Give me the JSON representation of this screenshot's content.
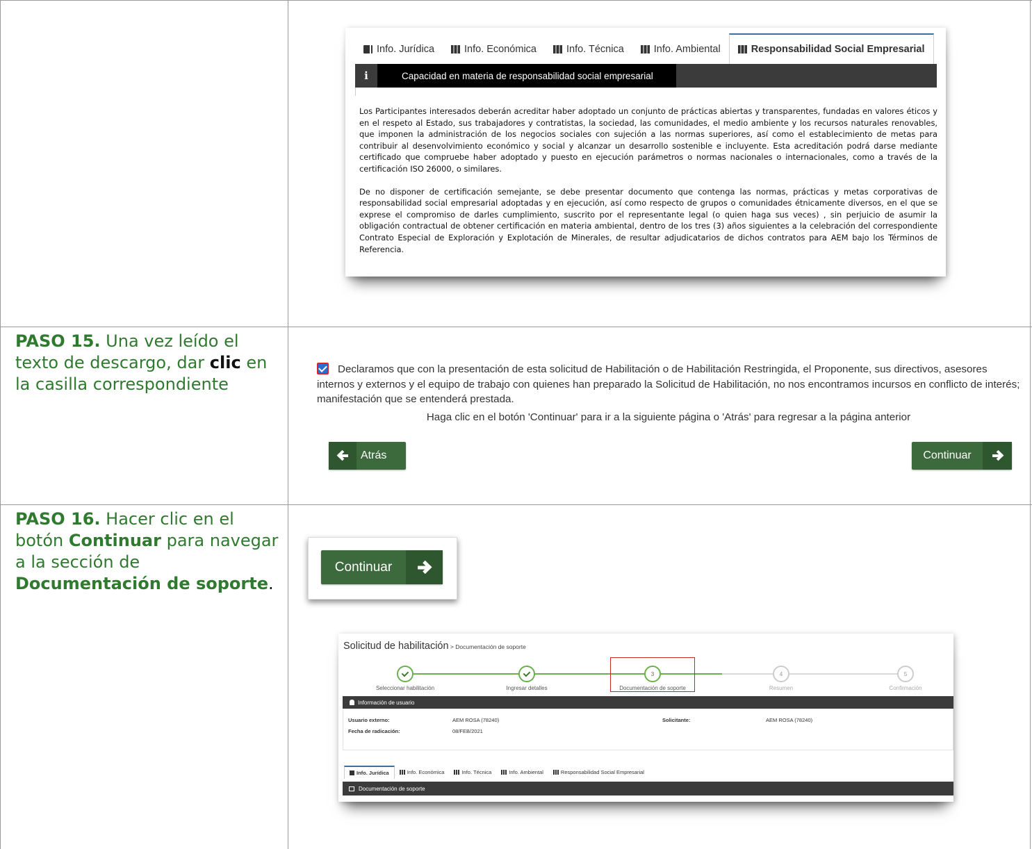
{
  "card1": {
    "tabs": [
      {
        "label": "Info. Jurídica",
        "icon": "book-icon"
      },
      {
        "label": "Info. Económica",
        "icon": "map-icon"
      },
      {
        "label": "Info. Técnica",
        "icon": "map-icon"
      },
      {
        "label": "Info. Ambiental",
        "icon": "map-icon"
      },
      {
        "label": "Responsabilidad Social Empresarial",
        "icon": "map-icon",
        "active": true
      }
    ],
    "info_icon": "i",
    "info_title": "Capacidad en materia de responsabilidad social empresarial",
    "paragraph1": "Los Participantes interesados deberán acreditar haber adoptado un conjunto de prácticas abiertas y transparentes, fundadas en valores éticos y en el respeto al Estado, sus trabajadores y contratistas, la sociedad, las comunidades, el medio ambiente y los recursos naturales renovables, que imponen la administración de los negocios sociales con sujeción a las normas superiores, así como el establecimiento de metas para contribuir al desenvolvimiento económico y social y alcanzar un desarrollo sostenible e incluyente. Esta acreditación podrá darse mediante certificado que compruebe haber adoptado y puesto en ejecución parámetros o normas nacionales o internacionales, como a través de la certificación ISO 26000, o similares.",
    "paragraph2": "De no disponer de certificación semejante, se debe presentar documento que contenga las normas, prácticas y metas corporativas de responsabilidad social empresarial adoptadas y en ejecución, así como respecto de grupos o comunidades étnicamente diversos, en el que se exprese el compromiso de darles cumplimiento, suscrito por el representante legal (o quien haga sus veces) , sin perjuicio de asumir la obligación contractual de obtener certificación en materia ambiental, dentro de los tres (3) años siguientes a la celebración del correspondiente Contrato Especial de Exploración y Explotación de Minerales, de resultar adjudicatarios de dichos contratos para AEM bajo los Términos de Referencia."
  },
  "step15": {
    "label": "PASO 15.",
    "text_a": " Una vez leído el texto de descargo, dar ",
    "bold": "clic",
    "text_b": " en la casilla correspondiente",
    "declaration": "Declaramos que con la presentación de esta solicitud de Habilitación o de Habilitación Restringida, el Proponente, sus directivos, asesores internos y externos y el equipo de trabajo con quienes han preparado la Solicitud de Habilitación, no nos encontramos incursos en conflicto de interés; manifestación que se entenderá prestada.",
    "checked": true,
    "hint": "Haga clic en el botón 'Continuar' para ir a la siguiente página o 'Atrás' para regresar a la página anterior",
    "back_label": "Atrás",
    "continue_label": "Continuar"
  },
  "step16": {
    "label": "PASO 16.",
    "text_a": " Hacer clic en el botón ",
    "bold1": "Continuar",
    "text_b": " para navegar a la sección de ",
    "bold2": "Documentación de soporte",
    "text_c": ".",
    "zoom_button_label": "Continuar"
  },
  "card2": {
    "title": "Solicitud de habilitación",
    "breadcrumb": " > Documentación de soporte",
    "steps": [
      {
        "number": "",
        "label": "Seleccionar habilitación",
        "state": "done"
      },
      {
        "number": "",
        "label": "Ingresar detalles",
        "state": "done"
      },
      {
        "number": "3",
        "label": "Documentación de soporte",
        "state": "current"
      },
      {
        "number": "4",
        "label": "Resumen",
        "state": "pending"
      },
      {
        "number": "5",
        "label": "Confirmación",
        "state": "pending"
      }
    ],
    "user_bar": "Información de usuario",
    "fields": {
      "external_user_label": "Usuario externo:",
      "external_user_value": "AEM ROSA (78240)",
      "date_label": "Fecha de radicación:",
      "date_value": "08/FEB/2021",
      "applicant_label": "Solicitante:",
      "applicant_value": "AEM ROSA (78240)"
    },
    "tabs": [
      "Info. Jurídica",
      "Info. Económica",
      "Info. Técnica",
      "Info. Ambiental",
      "Responsabilidad Social Empresarial"
    ],
    "doc_bar": "Documentación de soporte"
  },
  "colors": {
    "step_text": "#2f7a2f",
    "button": "#3c6a3c",
    "progress": "#6ab04c",
    "highlight": "#c62828"
  }
}
